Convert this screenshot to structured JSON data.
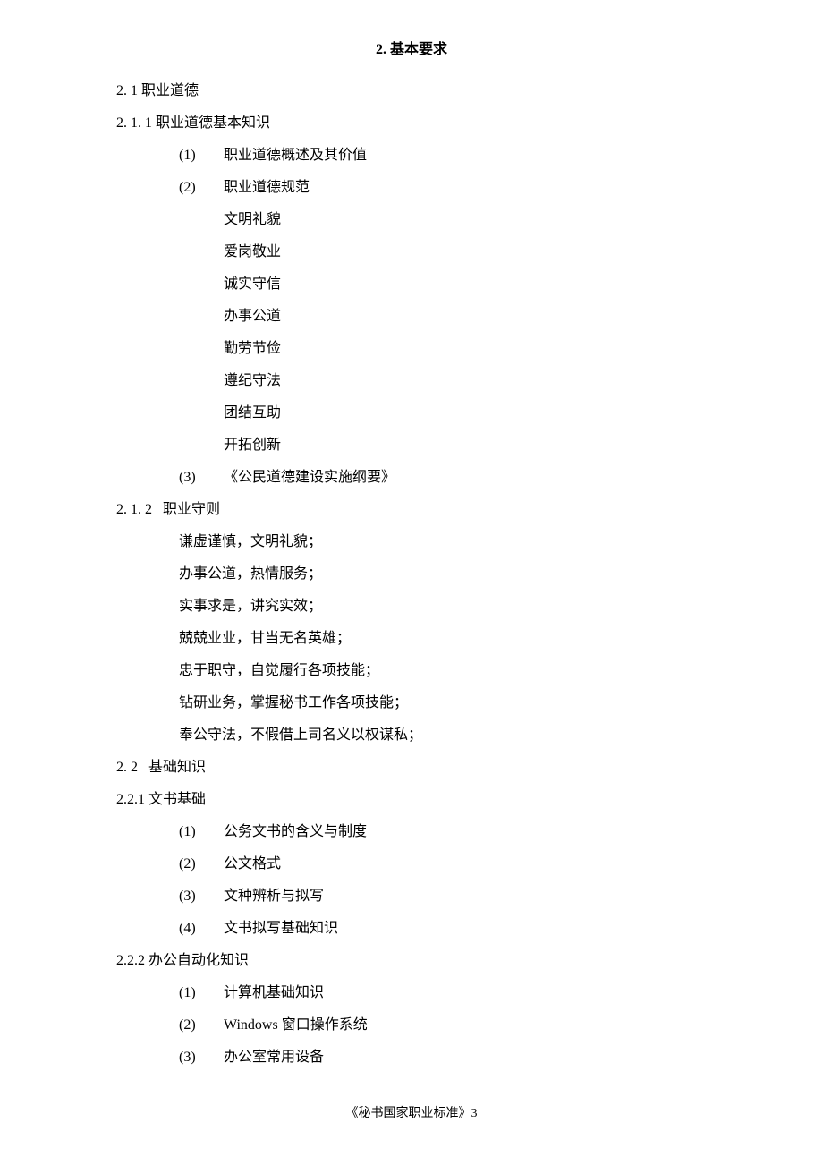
{
  "title": "2. 基本要求",
  "sections": {
    "s21": "2. 1 职业道德",
    "s211": "2. 1. 1 职业道德基本知识",
    "s211_items": {
      "n1": "(1)",
      "t1": "职业道德概述及其价值",
      "n2": "(2)",
      "t2": "职业道德规范",
      "sub": [
        "文明礼貌",
        "爱岗敬业",
        "诚实守信",
        "办事公道",
        "勤劳节俭",
        "遵纪守法",
        "团结互助",
        "开拓创新"
      ],
      "n3": "(3)",
      "t3": "《公民道德建设实施纲要》"
    },
    "s212": "2. 1. 2   职业守则",
    "s212_items": [
      "谦虚谨慎，文明礼貌；",
      "办事公道，热情服务；",
      "实事求是，讲究实效；",
      "兢兢业业，甘当无名英雄；",
      "忠于职守，自觉履行各项技能；",
      "钻研业务，掌握秘书工作各项技能；",
      "奉公守法，不假借上司名义以权谋私；"
    ],
    "s22": "2. 2   基础知识",
    "s221": "2.2.1 文书基础",
    "s221_items": {
      "n1": "(1)",
      "t1": "公务文书的含义与制度",
      "n2": "(2)",
      "t2": "公文格式",
      "n3": "(3)",
      "t3": "文种辨析与拟写",
      "n4": "(4)",
      "t4": "文书拟写基础知识"
    },
    "s222": "2.2.2 办公自动化知识",
    "s222_items": {
      "n1": "(1)",
      "t1": "计算机基础知识",
      "n2": "(2)",
      "t2": "Windows 窗口操作系统",
      "n3": "(3)",
      "t3": "办公室常用设备"
    }
  },
  "footer": "《秘书国家职业标准》3"
}
